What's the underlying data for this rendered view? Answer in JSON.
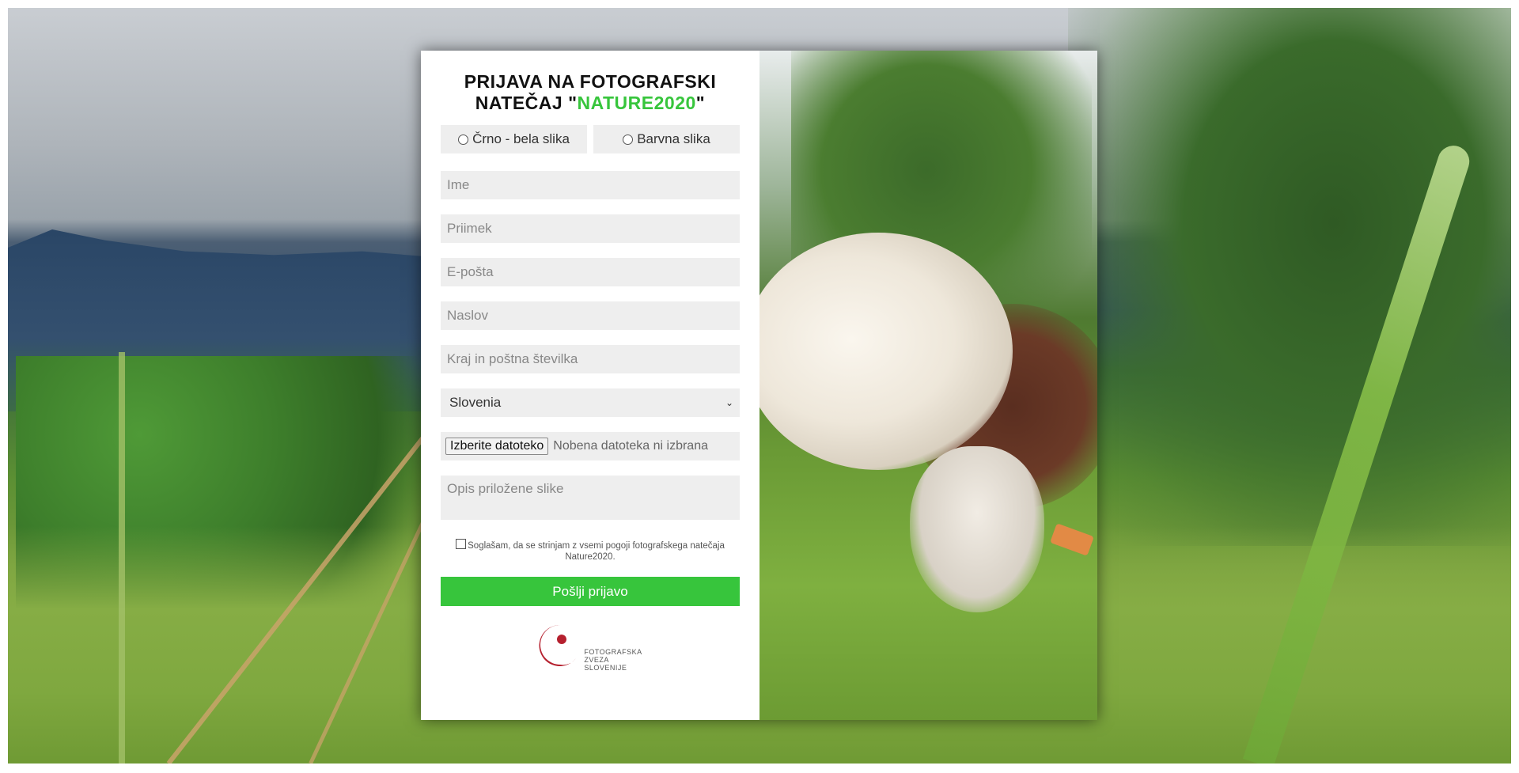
{
  "form": {
    "title_line1": "PRIJAVA NA FOTOGRAFSKI",
    "title_line2_prefix": "NATEČAJ \"",
    "title_accent": "NATURE2020",
    "title_line2_suffix": "\"",
    "radio_bw": "Črno - bela slika",
    "radio_color": "Barvna slika",
    "first_name_placeholder": "Ime",
    "last_name_placeholder": "Priimek",
    "email_placeholder": "E-pošta",
    "address_placeholder": "Naslov",
    "city_placeholder": "Kraj in poštna številka",
    "country_selected": "Slovenia",
    "file_button": "Izberite datoteko",
    "file_status": "Nobena datoteka ni izbrana",
    "description_placeholder": "Opis priložene slike",
    "consent_text": "Soglašam, da se strinjam z vsemi pogoji fotografskega natečaja Nature2020.",
    "submit_label": "Pošlji prijavo",
    "logo_line1": "FOTOGRAFSKA",
    "logo_line2": "ZVEZA",
    "logo_line3": "SLOVENIJE"
  },
  "colors": {
    "accent": "#37c53c",
    "field_bg": "#eeeeee",
    "logo_red": "#b5202e"
  },
  "icons": {
    "chevron": "chevron-down-icon",
    "logo": "fzs-logo-icon"
  }
}
